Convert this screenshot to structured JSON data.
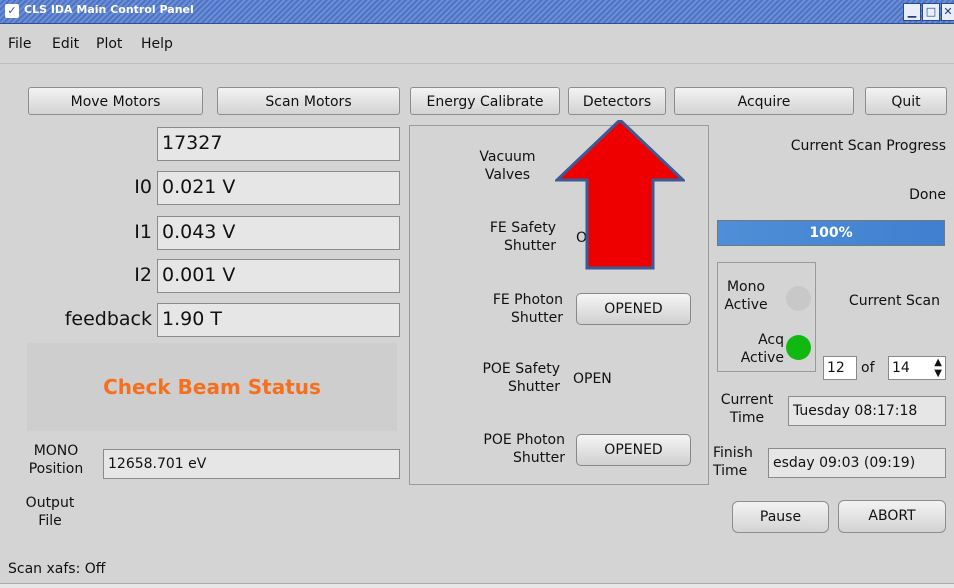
{
  "window": {
    "title": "CLS IDA Main Control Panel"
  },
  "menu": [
    "File",
    "Edit",
    "Plot",
    "Help"
  ],
  "toolbar": [
    "Move Motors",
    "Scan Motors",
    "Energy Calibrate",
    "Detectors",
    "Acquire",
    "Quit"
  ],
  "readings": {
    "top_value": "17327",
    "i0_label": "I0",
    "i0_value": "0.021 V",
    "i1_label": "I1",
    "i1_value": "0.043 V",
    "i2_label": "I2",
    "i2_value": "0.001 V",
    "feedback_label": "feedback",
    "feedback_value": "1.90 T"
  },
  "beam_status": "Check Beam Status",
  "mono": {
    "label_line1": "MONO",
    "label_line2": "Position",
    "value": "12658.701 eV"
  },
  "output_file": {
    "label_line1": "Output",
    "label_line2": "File"
  },
  "statusbar": "Scan xafs: Off",
  "shutters": {
    "vacuum_line1": "Vacuum",
    "vacuum_line2": "Valves",
    "fe_safety_line1": "FE Safety",
    "fe_safety_line2": "Shutter",
    "fe_safety_state": "O",
    "fe_photon_line1": "FE Photon",
    "fe_photon_line2": "Shutter",
    "fe_photon_state": "OPENED",
    "poe_safety_line1": "POE Safety",
    "poe_safety_line2": "Shutter",
    "poe_safety_state": "OPEN",
    "poe_photon_line1": "POE Photon",
    "poe_photon_line2": "Shutter",
    "poe_photon_state": "OPENED"
  },
  "progress": {
    "title": "Current Scan Progress",
    "status": "Done",
    "percent_label": "100%",
    "fraction": 1.0
  },
  "activity": {
    "mono_line1": "Mono",
    "mono_line2": "Active",
    "acq_line1": "Acq",
    "acq_line2": "Active",
    "mono_led_color": "#c8c8c8",
    "acq_led_color": "#11b811"
  },
  "scan": {
    "label": "Current Scan",
    "current": "12",
    "of_label": "of",
    "total": "14"
  },
  "time": {
    "current_line1": "Current",
    "current_line2": "Time",
    "current_value": "Tuesday 08:17:18",
    "finish_line1": "Finish",
    "finish_line2": "Time",
    "finish_value": "esday 09:03  (09:19)"
  },
  "actions": {
    "pause": "Pause",
    "abort": "ABORT"
  },
  "colors": {
    "beam_status": "#f5701e",
    "arrow_fill": "#ee0000",
    "arrow_stroke": "#3c5a96"
  }
}
